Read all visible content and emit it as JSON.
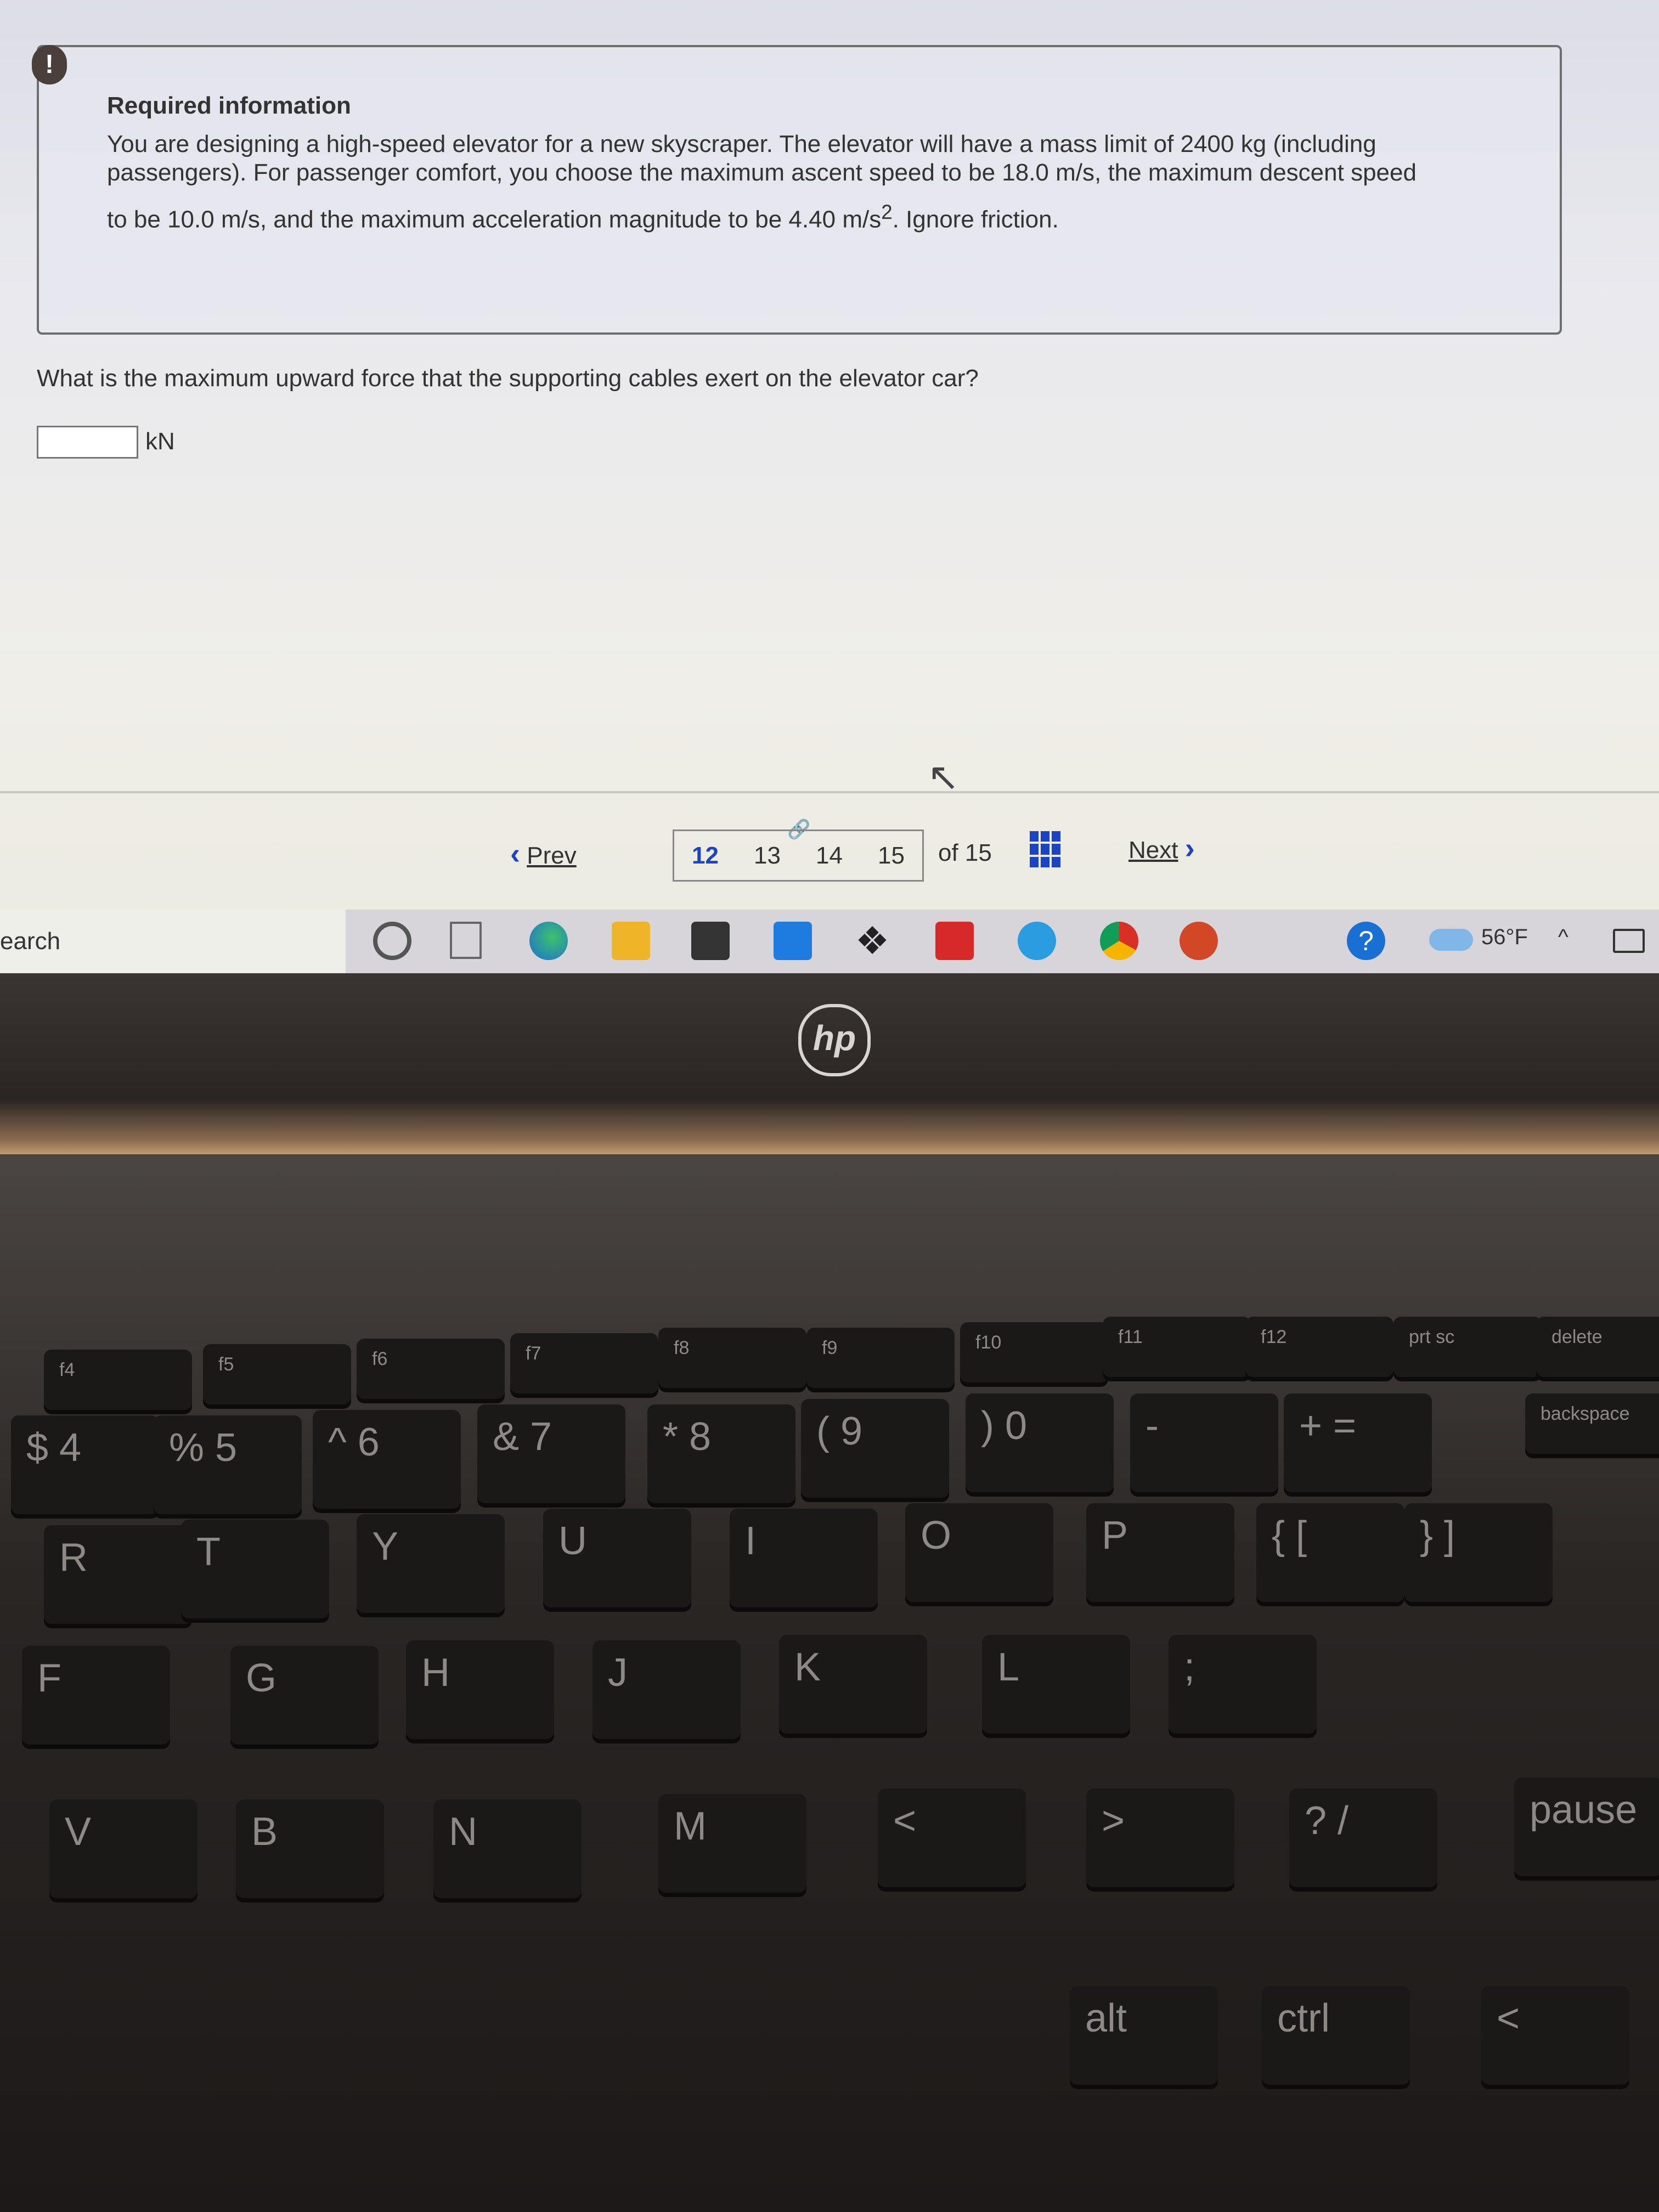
{
  "info": {
    "title": "Required information",
    "lines": [
      "You are designing a high-speed elevator for a new skyscraper. The elevator will have a mass limit of 2400 kg (including",
      "passengers). For passenger comfort, you choose the maximum ascent speed to be 18.0 m/s, the maximum descent speed",
      "to be 10.0 m/s, and the maximum acceleration magnitude to be 4.40 m/s"
    ],
    "superscript": "2",
    "line3_end": ". Ignore friction."
  },
  "question": {
    "text": "What is the maximum upward force that the supporting cables exert on the elevator car?",
    "answer_value": "",
    "unit": "kN"
  },
  "pagination": {
    "prev_label": "Prev",
    "pages": [
      "12",
      "13",
      "14",
      "15"
    ],
    "current_page": "12",
    "of_label": "of 15",
    "next_label": "Next"
  },
  "taskbar": {
    "search_text": "earch",
    "icons": [
      "cortana-circle-icon",
      "task-view-icon",
      "edge-icon",
      "file-explorer-icon",
      "microsoft-store-icon",
      "mail-icon",
      "dropbox-icon",
      "red-app-icon",
      "internet-explorer-icon",
      "chrome-icon",
      "powerpoint-icon"
    ],
    "temperature": "56°F"
  },
  "brand": "hp",
  "keyboard": {
    "keys": [
      "f4",
      "f5",
      "f6",
      "f7",
      "f8",
      "f9",
      "f10",
      "f11",
      "f12",
      "prt sc",
      "delete",
      "$ 4",
      "% 5",
      "^ 6",
      "& 7",
      "* 8",
      "( 9",
      ") 0",
      "-",
      "+ =",
      "backspace",
      "R",
      "T",
      "Y",
      "U",
      "I",
      "O",
      "P",
      "{ [",
      "} ]",
      "F",
      "G",
      "H",
      "J",
      "K",
      "L",
      ";",
      "V",
      "B",
      "N",
      "M",
      "<",
      ">",
      "? /",
      "pause",
      "alt",
      "ctrl",
      "<"
    ]
  },
  "colors": {
    "accent": "#1a44c4",
    "alert": "#4a3f3a"
  }
}
